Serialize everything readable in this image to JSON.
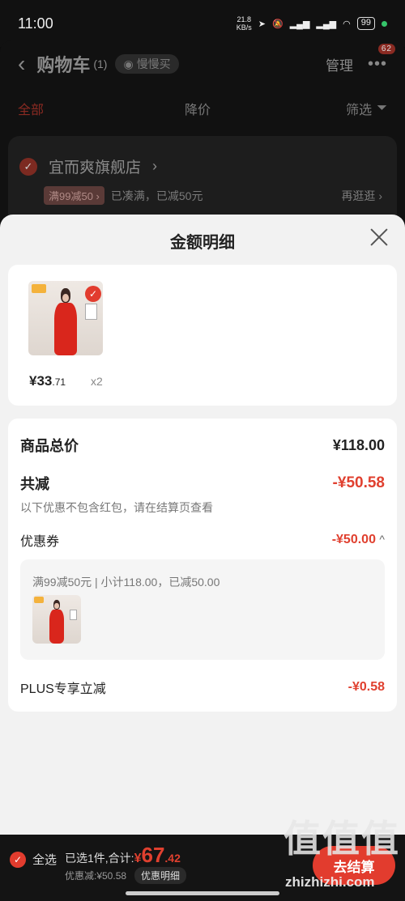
{
  "status_bar": {
    "time": "11:00",
    "net_speed": "21.8",
    "net_unit": "KB/s",
    "battery": "99"
  },
  "header": {
    "back_icon": "‹",
    "title": "购物车",
    "count": "(1)",
    "slow_buy": "慢慢买",
    "manage": "管理",
    "more_badge": "62"
  },
  "tabs": {
    "all": "全部",
    "price_drop": "降价",
    "filter": "筛选"
  },
  "store": {
    "name": "宜而爽旗舰店",
    "promo_tag": "满99减50",
    "promo_status": "已凑满，已减50元",
    "browse": "再逛逛"
  },
  "sheet": {
    "title": "金额明细",
    "product": {
      "price_int": "¥33",
      "price_dec": ".71",
      "qty": "x2"
    },
    "goods_total_label": "商品总价",
    "goods_total": "¥118.00",
    "discount_label": "共减",
    "discount_total": "-¥50.58",
    "note": "以下优惠不包含红包，请在结算页查看",
    "coupon_label": "优惠券",
    "coupon_value": "-¥50.00",
    "coupon_detail": "满99减50元 | 小计118.00，已减50.00",
    "plus_label": "PLUS专享立减",
    "plus_value": "-¥0.58"
  },
  "bottom_bar": {
    "select_all": "全选",
    "selected_text": "已选1件,合计:",
    "total_yen": "¥",
    "total_int": "67",
    "total_dec": ".42",
    "saved": "优惠减:¥50.58",
    "detail_button": "优惠明细",
    "checkout": "去结算"
  },
  "watermark": {
    "chars": "值值值",
    "url": "zhizhizhi.com"
  },
  "colors": {
    "accent": "#e23c2e",
    "sheet_bg": "#f2f2f2"
  }
}
